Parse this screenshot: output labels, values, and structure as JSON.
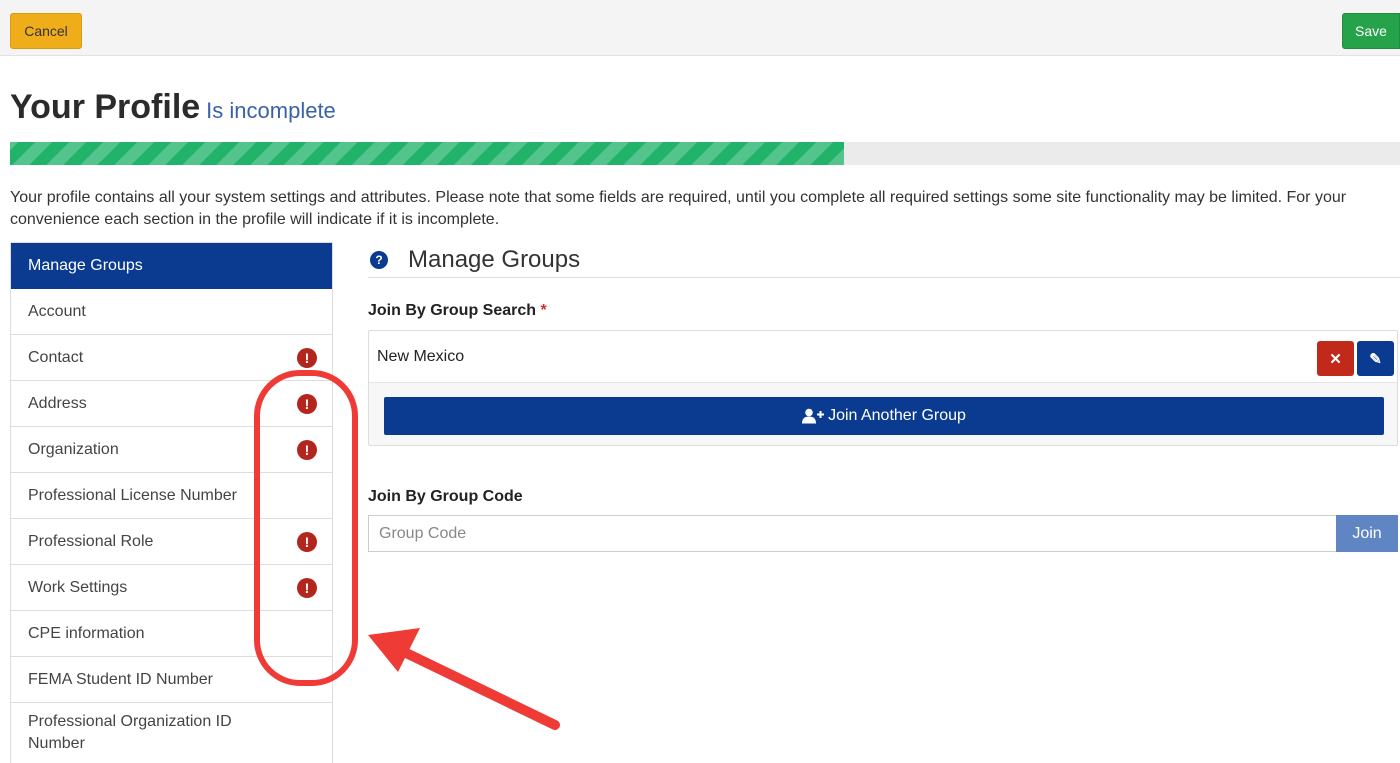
{
  "toolbar": {
    "cancel_label": "Cancel",
    "save_label": "Save"
  },
  "header": {
    "title": "Your Profile",
    "status": "Is incomplete"
  },
  "progress": {
    "fraction": 0.6
  },
  "description": "Your profile contains all your system settings and attributes. Please note that some fields are required, until you complete all required settings some site functionality may be limited. For your convenience each section in the profile will indicate if it is incomplete.",
  "sidebar": {
    "items": [
      {
        "label": "Manage Groups",
        "active": true,
        "incomplete": false
      },
      {
        "label": "Account",
        "active": false,
        "incomplete": false
      },
      {
        "label": "Contact",
        "active": false,
        "incomplete": true
      },
      {
        "label": "Address",
        "active": false,
        "incomplete": true
      },
      {
        "label": "Organization",
        "active": false,
        "incomplete": true
      },
      {
        "label": "Professional License Number",
        "active": false,
        "incomplete": false
      },
      {
        "label": "Professional Role",
        "active": false,
        "incomplete": true
      },
      {
        "label": "Work Settings",
        "active": false,
        "incomplete": true
      },
      {
        "label": "CPE information",
        "active": false,
        "incomplete": false
      },
      {
        "label": "FEMA Student ID Number",
        "active": false,
        "incomplete": false
      },
      {
        "label": "Professional Organization ID Number",
        "active": false,
        "incomplete": false
      }
    ],
    "warning_glyph": "!"
  },
  "main": {
    "help_glyph": "?",
    "title": "Manage Groups",
    "group_search": {
      "label": "Join By Group Search",
      "required_marker": "*",
      "selected_group": "New Mexico",
      "remove_glyph": "✕",
      "edit_glyph": "✎",
      "join_another_label": "Join Another Group",
      "join_another_icon": "user-plus-icon"
    },
    "group_code": {
      "label": "Join By Group Code",
      "placeholder": "Group Code",
      "value": "",
      "join_label": "Join"
    }
  },
  "colors": {
    "primary": "#0a3b91",
    "warning": "#b3261e",
    "success": "#22b36b",
    "cancel": "#f0ad1a",
    "save": "#26a34a",
    "annotation": "#ef3b36"
  }
}
